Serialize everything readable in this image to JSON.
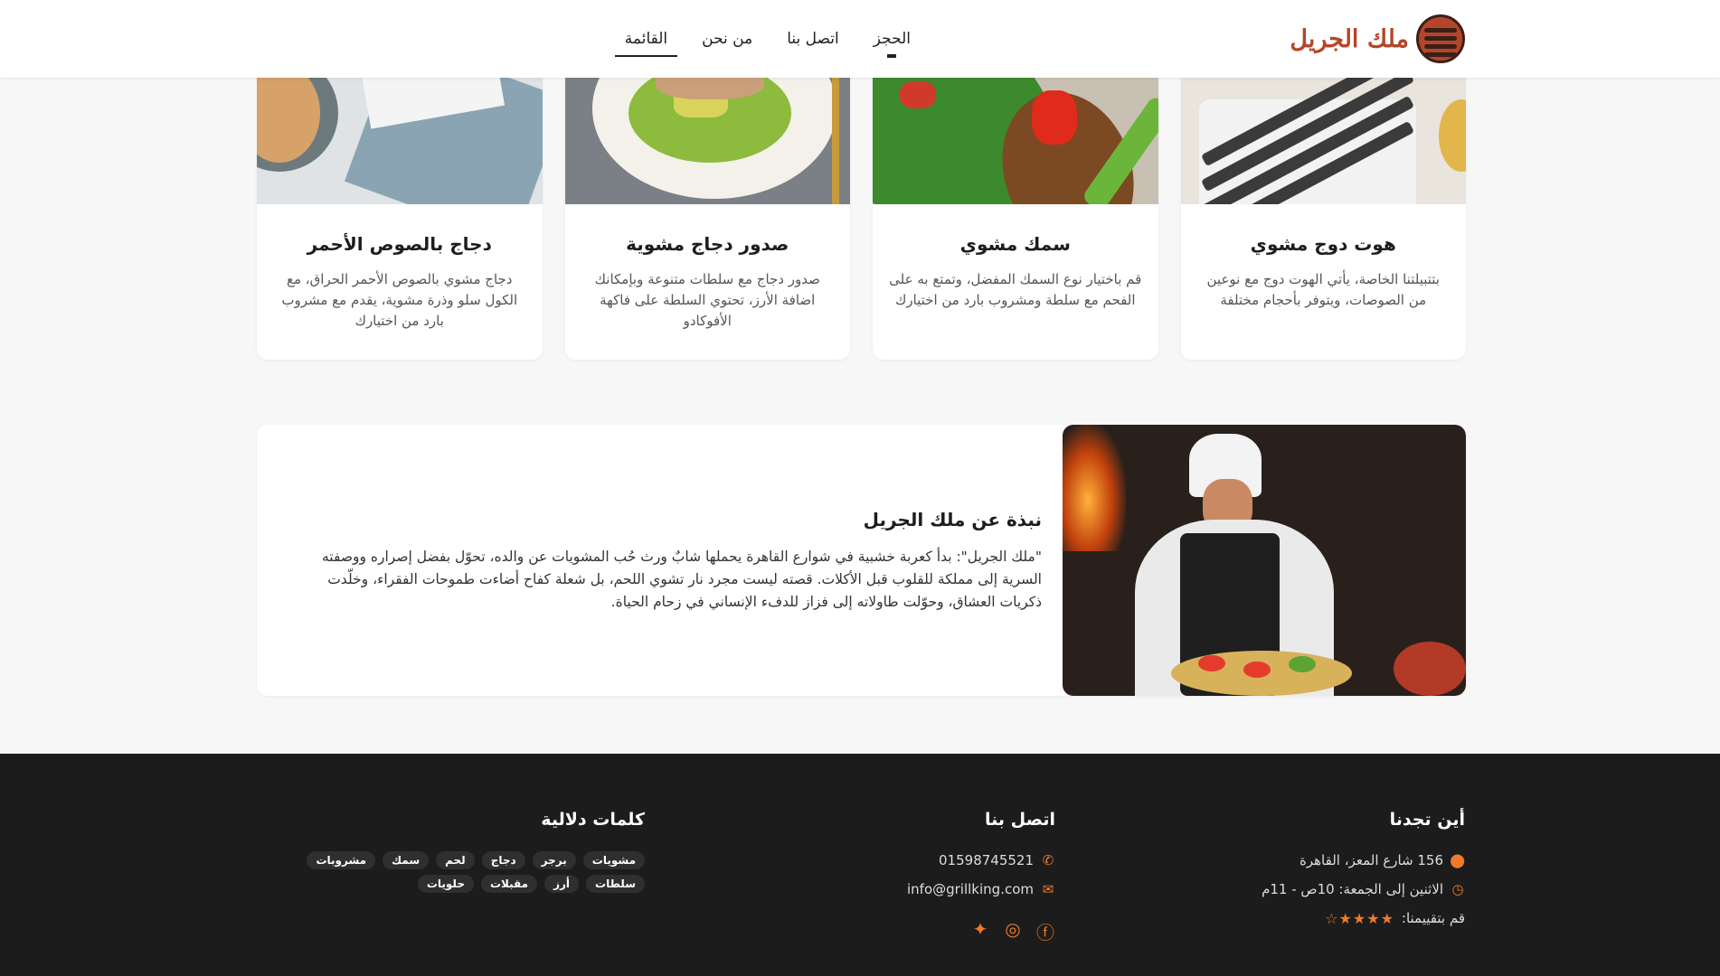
{
  "header": {
    "brand": "ملك الجريل",
    "nav": [
      "القائمة",
      "من نحن",
      "اتصل بنا",
      "الحجز"
    ]
  },
  "cards": [
    {
      "title": "هوت دوج مشوي",
      "desc": "بتتبيلتنا الخاصة، يأتي الهوت دوج مع نوعين من الصوصات، ويتوفر بأحجام مختلفة"
    },
    {
      "title": "سمك مشوي",
      "desc": "قم باختيار نوع السمك المفضل، وتمتع به على الفحم مع سلطة ومشروب بارد من اختيارك"
    },
    {
      "title": "صدور دجاج مشوية",
      "desc": "صدور دجاج مع سلطات متنوعة وبإمكانك اضافة الأرز، تحتوي السلطة على فاكهة الأفوكادو"
    },
    {
      "title": "دجاج بالصوص الأحمر",
      "desc": "دجاج مشوي بالصوص الأحمر الحراق، مع الكول سلو وذرة مشوية، يقدم مع مشروب بارد من اختيارك"
    }
  ],
  "about": {
    "title": "نبذة عن ملك الجريل",
    "text": "\"ملك الجريل\": بدأ كعربة خشبية في شوارع القاهرة يحملها شابٌ ورث حُب المشويات عن والده، تحوّل بفضل إصراره ووصفته السرية إلى مملكة للقلوب قبل الأكلات. قصته ليست مجرد نار تشوي اللحم، بل شعلة كفاح أضاءت طموحات الفقراء، وخلّدت ذكريات العشاق، وحوّلت طاولاته إلى فزاز للدفء الإنساني في زحام الحياة."
  },
  "footer": {
    "location": {
      "title": "أين تجدنا",
      "address": "156 شارع المعز، القاهرة",
      "hours": "الاثنين إلى الجمعة: 10ص - 11م",
      "rate_label": "قم بتقييمنا:",
      "rating": 4.5,
      "stars": "★★★★☆"
    },
    "contact": {
      "title": "اتصل بنا",
      "phone": "01598745521",
      "email": "info@grillking.com"
    },
    "keywords": {
      "title": "كلمات دلالية",
      "tags": [
        "مشويات",
        "برجر",
        "دجاج",
        "لحم",
        "سمك",
        "مشروبات",
        "سلطات",
        "أرز",
        "مقبلات",
        "حلويات"
      ]
    }
  },
  "colors": {
    "accent": "#f07a2a",
    "brand": "#b5452a",
    "footer_bg": "#1c1c1c"
  }
}
